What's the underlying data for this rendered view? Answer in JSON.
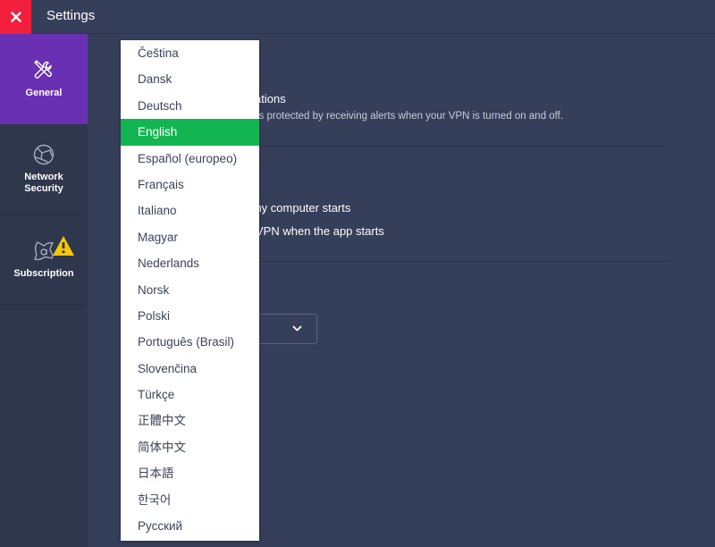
{
  "window": {
    "title": "Settings",
    "close_icon": "close-x-icon"
  },
  "sidebar": {
    "items": [
      {
        "label": "General",
        "icon": "tools-icon",
        "active": true
      },
      {
        "label": "Network Security",
        "icon": "globe-network-icon",
        "active": false
      },
      {
        "label": "Subscription",
        "icon": "avast-logo-icon",
        "badge": "warning-icon",
        "active": false
      }
    ]
  },
  "content": {
    "notifications": {
      "title_partial": "fications",
      "description_partial": "is protected by receiving alerts when your VPN is turned on and off."
    },
    "startup": {
      "option1_partial": "n my computer starts",
      "option2_partial": "VPN when the app starts"
    },
    "language_select": {
      "value": "English",
      "chevron_icon": "chevron-down-icon"
    }
  },
  "language_dropdown": {
    "selected": "English",
    "options": [
      "Čeština",
      "Dansk",
      "Deutsch",
      "English",
      "Español (europeo)",
      "Français",
      "Italiano",
      "Magyar",
      "Nederlands",
      "Norsk",
      "Polski",
      "Português (Brasil)",
      "Slovenčina",
      "Türkçe",
      "正體中文",
      "简体中文",
      "日本語",
      "한국어",
      "Русский"
    ]
  },
  "colors": {
    "accent_active": "#6930b4",
    "close_red": "#f2203d",
    "selected_green": "#13b552",
    "warning_yellow": "#f5c800",
    "background": "#363f5a",
    "sidebar": "#2f374d"
  }
}
